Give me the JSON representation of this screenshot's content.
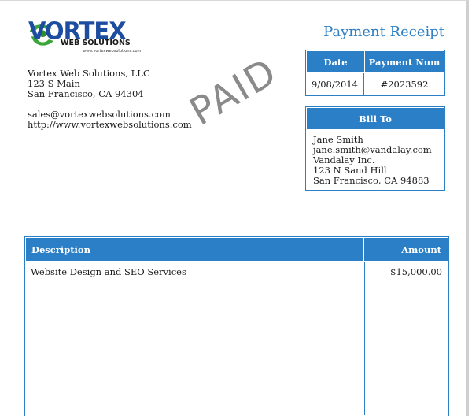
{
  "logo": {
    "wordmark": "VORTEX",
    "subtitle": "WEB SOLUTIONS",
    "tagline_url": "www.vortexwebsolutions.com",
    "colors": {
      "green": "#3aa63a",
      "blue": "#1c4da0"
    }
  },
  "company": {
    "name": "Vortex Web Solutions, LLC",
    "street": "123 S Main",
    "city": "San Francisco, CA 94304",
    "email": "sales@vortexwebsolutions.com",
    "website": "http://www.vortexwebsolutions.com"
  },
  "stamp": "PAID",
  "title": "Payment Receipt",
  "payment": {
    "headers": {
      "date": "Date",
      "number": "Payment Num"
    },
    "date": "9/08/2014",
    "number": "#2023592"
  },
  "bill_to": {
    "header": "Bill To",
    "name": "Jane Smith",
    "email": "jane.smith@vandalay.com",
    "company": "Vandalay Inc.",
    "street": "123 N Sand Hill",
    "city": "San Francisco, CA 94883"
  },
  "items": {
    "headers": {
      "description": "Description",
      "amount": "Amount"
    },
    "rows": [
      {
        "description": "Website Design and SEO Services",
        "amount": "$15,000.00"
      }
    ]
  },
  "colors": {
    "accent": "#2a7fc6",
    "title": "#2f7fc4",
    "stamp": "#8a8a8a"
  }
}
